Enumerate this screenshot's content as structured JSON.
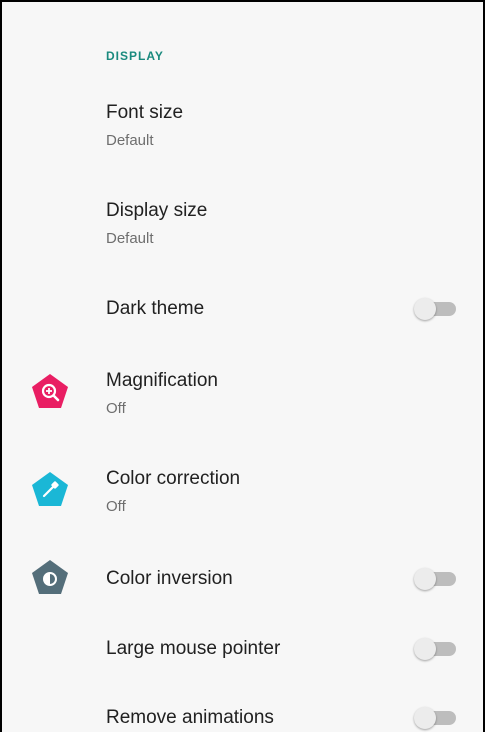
{
  "section": {
    "header": "DISPLAY"
  },
  "items": [
    {
      "title": "Font size",
      "summary": "Default"
    },
    {
      "title": "Display size",
      "summary": "Default"
    },
    {
      "title": "Dark theme",
      "toggle": false
    },
    {
      "title": "Magnification",
      "summary": "Off",
      "icon": "magnify-icon",
      "icon_color": "#e91e63"
    },
    {
      "title": "Color correction",
      "summary": "Off",
      "icon": "eyedropper-icon",
      "icon_color": "#1ab7d6"
    },
    {
      "title": "Color inversion",
      "toggle": false,
      "icon": "invert-colors-icon",
      "icon_color": "#546e7a"
    },
    {
      "title": "Large mouse pointer",
      "toggle": false
    },
    {
      "title": "Remove animations",
      "toggle": false
    }
  ],
  "colors": {
    "section_header": "#1a8a7e",
    "title_text": "#212121",
    "summary_text": "#6e6e6e",
    "toggle_track_off": "#bdbdbd",
    "toggle_thumb_off": "#ececec"
  }
}
